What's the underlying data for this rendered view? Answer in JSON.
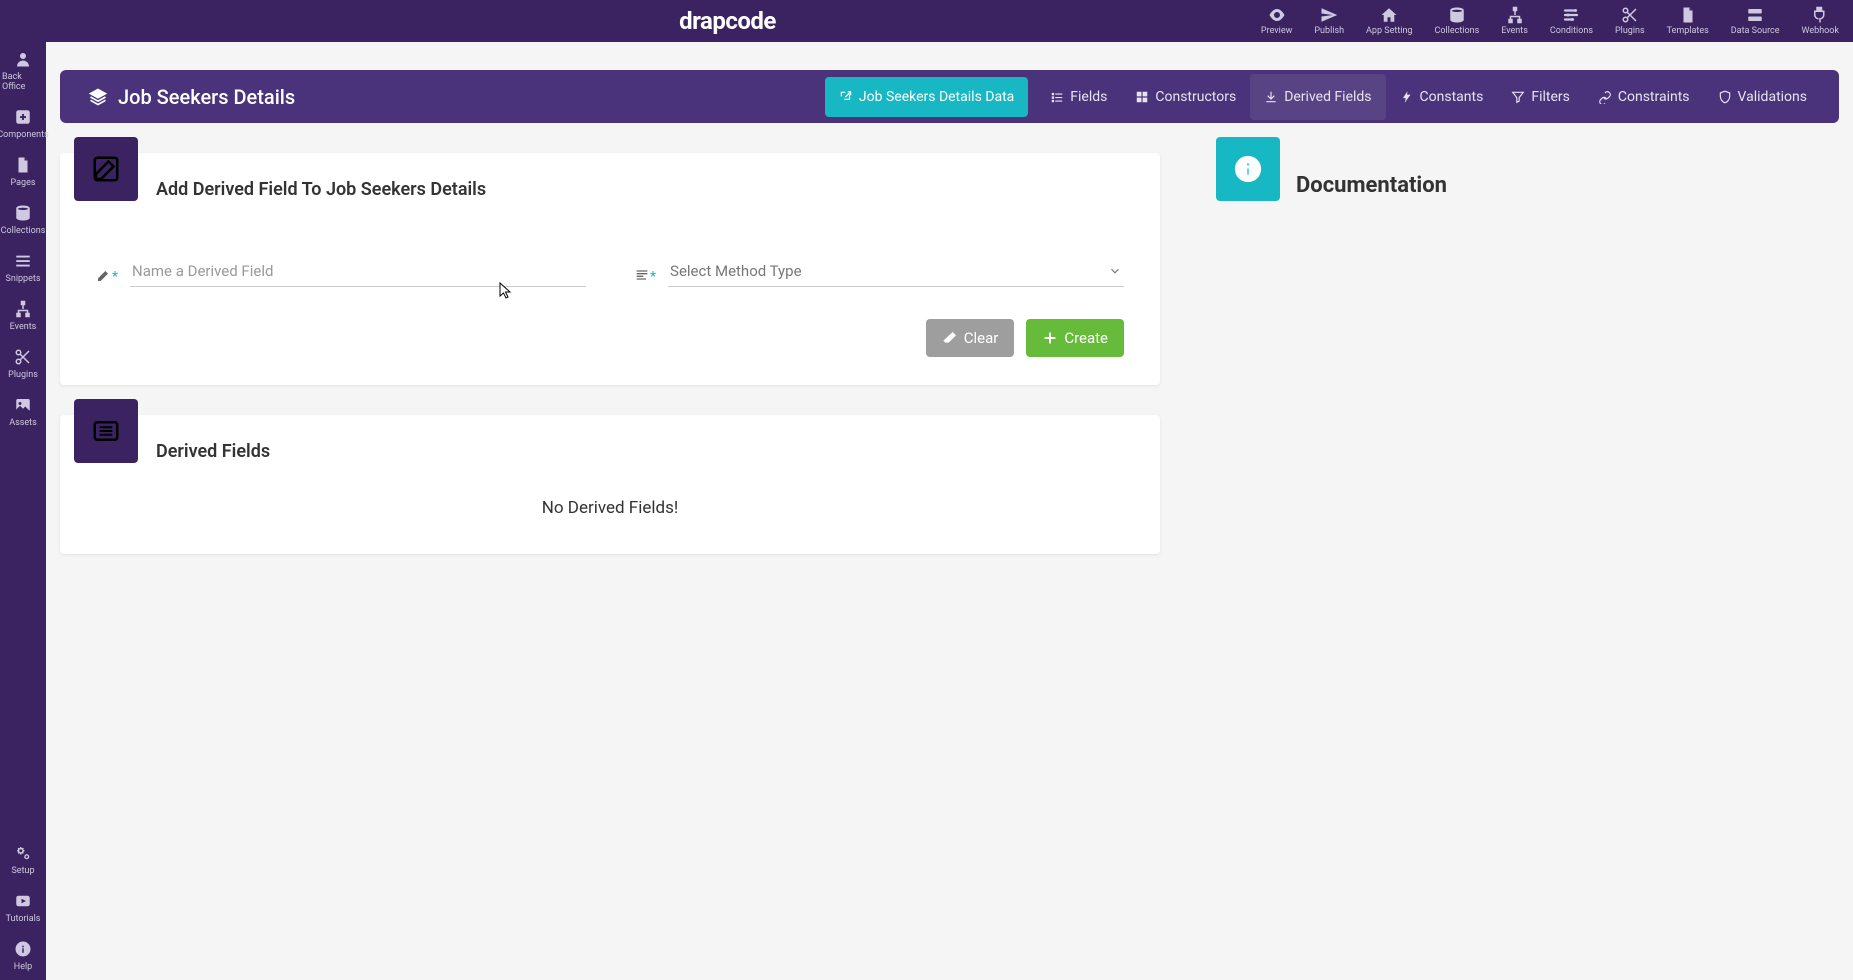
{
  "brand": "drapcode",
  "topbar": {
    "items": [
      {
        "label": "Preview",
        "icon": "eye"
      },
      {
        "label": "Publish",
        "icon": "send"
      },
      {
        "label": "App Setting",
        "icon": "home"
      },
      {
        "label": "Collections",
        "icon": "database"
      },
      {
        "label": "Events",
        "icon": "sitemap"
      },
      {
        "label": "Conditions",
        "icon": "sliders"
      },
      {
        "label": "Plugins",
        "icon": "scissors"
      },
      {
        "label": "Templates",
        "icon": "file"
      },
      {
        "label": "Data Source",
        "icon": "server"
      },
      {
        "label": "Webhook",
        "icon": "plug"
      }
    ]
  },
  "sidebar": {
    "top": [
      {
        "label": "Back Office",
        "icon": "user"
      },
      {
        "label": "Components",
        "icon": "plus-box"
      },
      {
        "label": "Pages",
        "icon": "file"
      },
      {
        "label": "Collections",
        "icon": "database"
      },
      {
        "label": "Snippets",
        "icon": "bars"
      },
      {
        "label": "Events",
        "icon": "sitemap"
      },
      {
        "label": "Plugins",
        "icon": "scissors"
      },
      {
        "label": "Assets",
        "icon": "image"
      }
    ],
    "bottom": [
      {
        "label": "Setup",
        "icon": "cogs"
      },
      {
        "label": "Tutorials",
        "icon": "play"
      },
      {
        "label": "Help",
        "icon": "info"
      }
    ]
  },
  "page": {
    "title": "Job Seekers Details",
    "tabs": [
      {
        "label": "Job Seekers Details Data",
        "icon": "external",
        "primary": true
      },
      {
        "label": "Fields",
        "icon": "fields"
      },
      {
        "label": "Constructors",
        "icon": "grid"
      },
      {
        "label": "Derived Fields",
        "icon": "import",
        "active": true
      },
      {
        "label": "Constants",
        "icon": "bolt"
      },
      {
        "label": "Filters",
        "icon": "filter"
      },
      {
        "label": "Constraints",
        "icon": "link"
      },
      {
        "label": "Validations",
        "icon": "shield"
      }
    ]
  },
  "form": {
    "heading": "Add Derived Field To Job Seekers Details",
    "name_placeholder": "Name a Derived Field",
    "method_placeholder": "Select Method Type",
    "clear_label": "Clear",
    "create_label": "Create"
  },
  "list": {
    "heading": "Derived Fields",
    "empty": "No Derived Fields!"
  },
  "doc": {
    "heading": "Documentation"
  },
  "colors": {
    "primary_dark": "#3a2360",
    "primary": "#4a337a",
    "teal": "#17b7c4",
    "green": "#66bb3a",
    "gray": "#9e9e9e"
  }
}
